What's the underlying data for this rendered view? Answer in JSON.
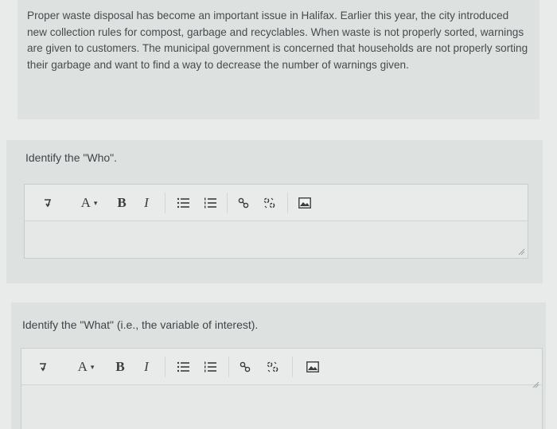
{
  "intro": {
    "text": "Proper waste disposal has become an important issue in Halifax. Earlier this year, the city introduced new collection rules for compost, garbage and recyclables. When waste is not properly sorted, warnings are given to customers. The municipal government is concerned that households are not properly sorting their garbage and want to find a way to decrease the number of warnings given."
  },
  "questions": [
    {
      "label": "Identify the \"Who\".",
      "answer": ""
    },
    {
      "label": "Identify the \"What\" (i.e., the variable of interest).",
      "answer": ""
    }
  ],
  "toolbar": {
    "font_label": "A",
    "font_caret": "▾",
    "bold_label": "B",
    "italic_label": "I",
    "icons": [
      "paragraph-icon",
      "font-color-icon",
      "bold-icon",
      "italic-icon",
      "bullet-list-icon",
      "numbered-list-icon",
      "link-icon",
      "unlink-icon",
      "image-icon"
    ]
  }
}
